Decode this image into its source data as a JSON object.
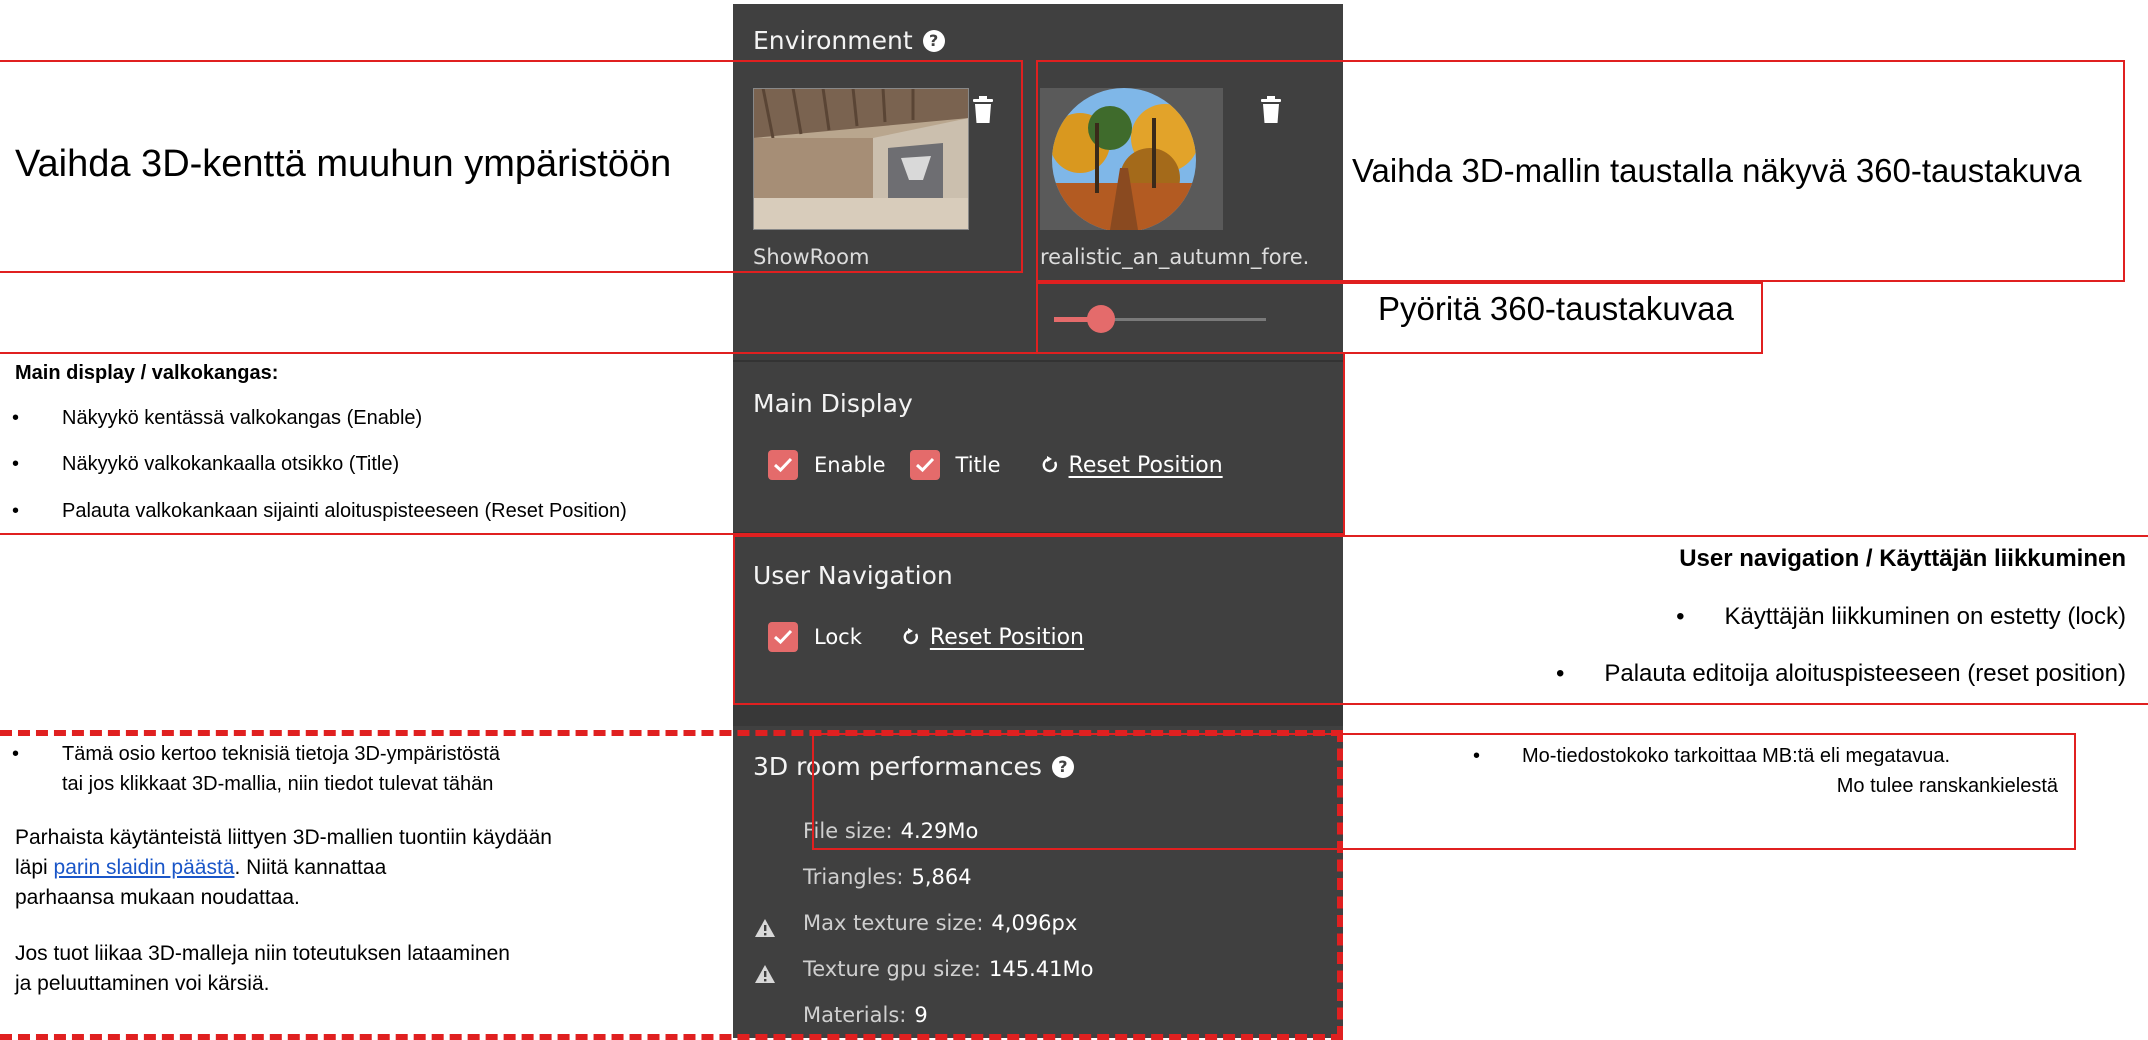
{
  "panel": {
    "environment": {
      "title": "Environment",
      "help_glyph": "?",
      "scene_label": "ShowRoom",
      "background_label": "realistic_an_autumn_fore..",
      "rotation_slider_value": 0.18
    },
    "main_display": {
      "title": "Main Display",
      "enable_label": "Enable",
      "title_label": "Title",
      "reset_label": "Reset Position"
    },
    "user_navigation": {
      "title": "User Navigation",
      "lock_label": "Lock",
      "reset_label": "Reset Position"
    },
    "performance": {
      "title": "3D room performances",
      "stats": [
        {
          "label": "File size:",
          "value": "4.29Mo"
        },
        {
          "label": "Triangles:",
          "value": "5,864"
        },
        {
          "label": "Max texture size:",
          "value": "4,096px"
        },
        {
          "label": "Texture gpu size:",
          "value": "145.41Mo"
        },
        {
          "label": "Materials:",
          "value": "9"
        }
      ]
    },
    "accent_color": "#e46b6b"
  },
  "annotations": {
    "environment_note": "Vaihda 3D-kenttä muuhun ympäristöön",
    "background_note": "Vaihda 3D-mallin taustalla näkyvä 360-taustakuva",
    "rotate_note": "Pyöritä 360-taustakuvaa",
    "main_display": {
      "heading": "Main display / valkokangas:",
      "items": [
        "Näkyykö kentässä valkokangas (Enable)",
        "Näkyykö valkokankaalla otsikko (Title)",
        "Palauta valkokankaan sijainti aloituspisteeseen (Reset Position)"
      ]
    },
    "user_navigation": {
      "heading": "User navigation / Käyttäjän liikkuminen",
      "items": [
        "Käyttäjän liikkuminen on estetty (lock)",
        "Palauta editoija aloituspisteeseen (reset position)"
      ]
    },
    "filesize_note_line1": "Mo-tiedostokoko tarkoittaa MB:tä eli megatavua.",
    "filesize_note_line2": "Mo  tulee ranskankielestä",
    "performance_note": {
      "bullet_line1": "Tämä osio kertoo teknisiä tietoja 3D-ympäristöstä",
      "bullet_line2": "tai jos klikkaat 3D-mallia, niin tiedot tulevat tähän",
      "para1_line1": "Parhaista käytänteistä liittyen 3D-mallien tuontiin käydään",
      "para1_prefix": "läpi ",
      "para1_link": "parin slaidin päästä",
      "para1_suffix": ". Niitä kannattaa",
      "para1_line3": "parhaansa mukaan noudattaa.",
      "para2_line1": "Jos tuot liikaa 3D-malleja niin toteutuksen lataaminen",
      "para2_line2": "ja peluuttaminen voi kärsiä."
    },
    "bullet_glyph": "•"
  }
}
